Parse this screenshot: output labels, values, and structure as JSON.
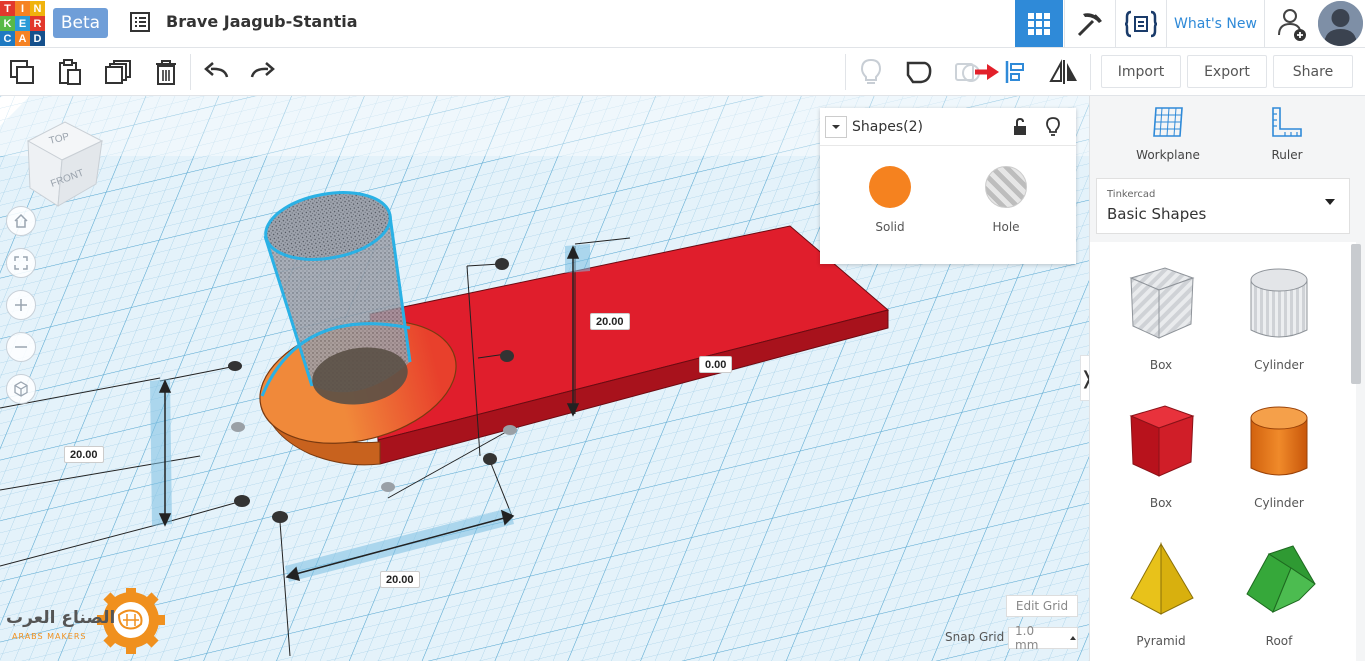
{
  "logo": {
    "letters": [
      "T",
      "I",
      "N",
      "K",
      "E",
      "R",
      "C",
      "A",
      "D"
    ],
    "colors": [
      "#e2382c",
      "#f58223",
      "#f0b30d",
      "#58b947",
      "#2a9bd7",
      "#2a9bd7",
      "#1f7ac2",
      "#1b63a8",
      "#15508c"
    ]
  },
  "header": {
    "beta_label": "Beta",
    "design_title": "Brave Jaagub-Stantia",
    "whats_new": "What's New"
  },
  "toolbar": {
    "import": "Import",
    "export": "Export",
    "share": "Share"
  },
  "shapes_panel": {
    "title": "Shapes(2)",
    "solid_label": "Solid",
    "hole_label": "Hole",
    "solid_color": "#f5821f"
  },
  "viewcube": {
    "top": "TOP",
    "front": "FRONT"
  },
  "dimensions": {
    "left_height": "20.00",
    "bottom_width": "20.00",
    "vertical_height": "20.00",
    "elevation": "0.00"
  },
  "grid_controls": {
    "edit_grid": "Edit Grid",
    "snap_grid_label": "Snap Grid",
    "snap_grid_value": "1.0 mm"
  },
  "brand": {
    "arabic": "الصناع العرب",
    "latin": "ARABS MAKERS"
  },
  "right_panel": {
    "workplane": "Workplane",
    "ruler": "Ruler",
    "library_small": "Tinkercad",
    "library_main": "Basic Shapes",
    "shapes": [
      {
        "label": "Box",
        "kind": "box-hole"
      },
      {
        "label": "Cylinder",
        "kind": "cylinder-hole"
      },
      {
        "label": "Box",
        "kind": "box-solid"
      },
      {
        "label": "Cylinder",
        "kind": "cylinder-solid"
      },
      {
        "label": "Pyramid",
        "kind": "pyramid"
      },
      {
        "label": "Roof",
        "kind": "roof"
      }
    ]
  },
  "colors": {
    "accent": "#2f8ad8",
    "red_box": "#e01e2c",
    "orange": "#f08a3c",
    "grid_bg": "#ddeef7"
  }
}
